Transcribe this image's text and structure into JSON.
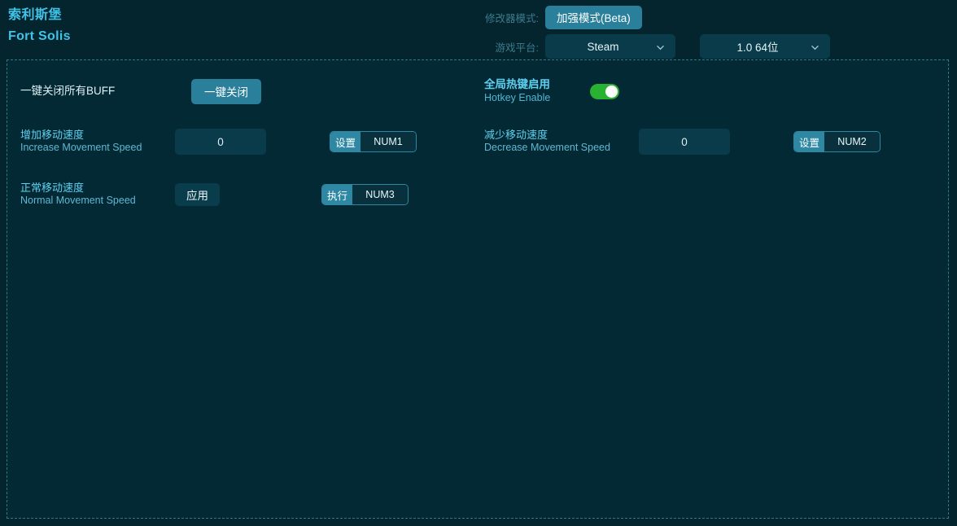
{
  "header": {
    "title_cn": "索利斯堡",
    "title_en": "Fort Solis",
    "mode_label": "修改器模式:",
    "mode_button": "加强模式(Beta)",
    "platform_label": "游戏平台:",
    "platform_value": "Steam",
    "version_value": "1.0 64位",
    "chevron_icon": "chevron-down-icon"
  },
  "panel": {
    "buff_row": {
      "label_cn": "一键关闭所有BUFF",
      "button": "一键关闭"
    },
    "hotkey_row": {
      "label_cn": "全局热键启用",
      "label_en": "Hotkey Enable",
      "toggle_state": "on"
    },
    "rows": [
      {
        "label_cn": "增加移动速度",
        "label_en": "Increase Movement Speed",
        "value": "0",
        "hotkey_action": "设置",
        "hotkey_key": "NUM1"
      },
      {
        "label_cn": "减少移动速度",
        "label_en": "Decrease Movement Speed",
        "value": "0",
        "hotkey_action": "设置",
        "hotkey_key": "NUM2"
      },
      {
        "label_cn": "正常移动速度",
        "label_en": "Normal Movement Speed",
        "button": "应用",
        "hotkey_action": "执行",
        "hotkey_key": "NUM3"
      }
    ]
  },
  "colors": {
    "background": "#04242e",
    "panel_background": "#032a34",
    "panel_border": "#2b7a8c",
    "accent_teal": "#2a7f9b",
    "title_blue": "#3fc3e8",
    "label_blue": "#5fd0f0",
    "muted_label": "#3c7d8e",
    "toggle_green": "#29b231",
    "input_background": "#0a3b4a"
  }
}
